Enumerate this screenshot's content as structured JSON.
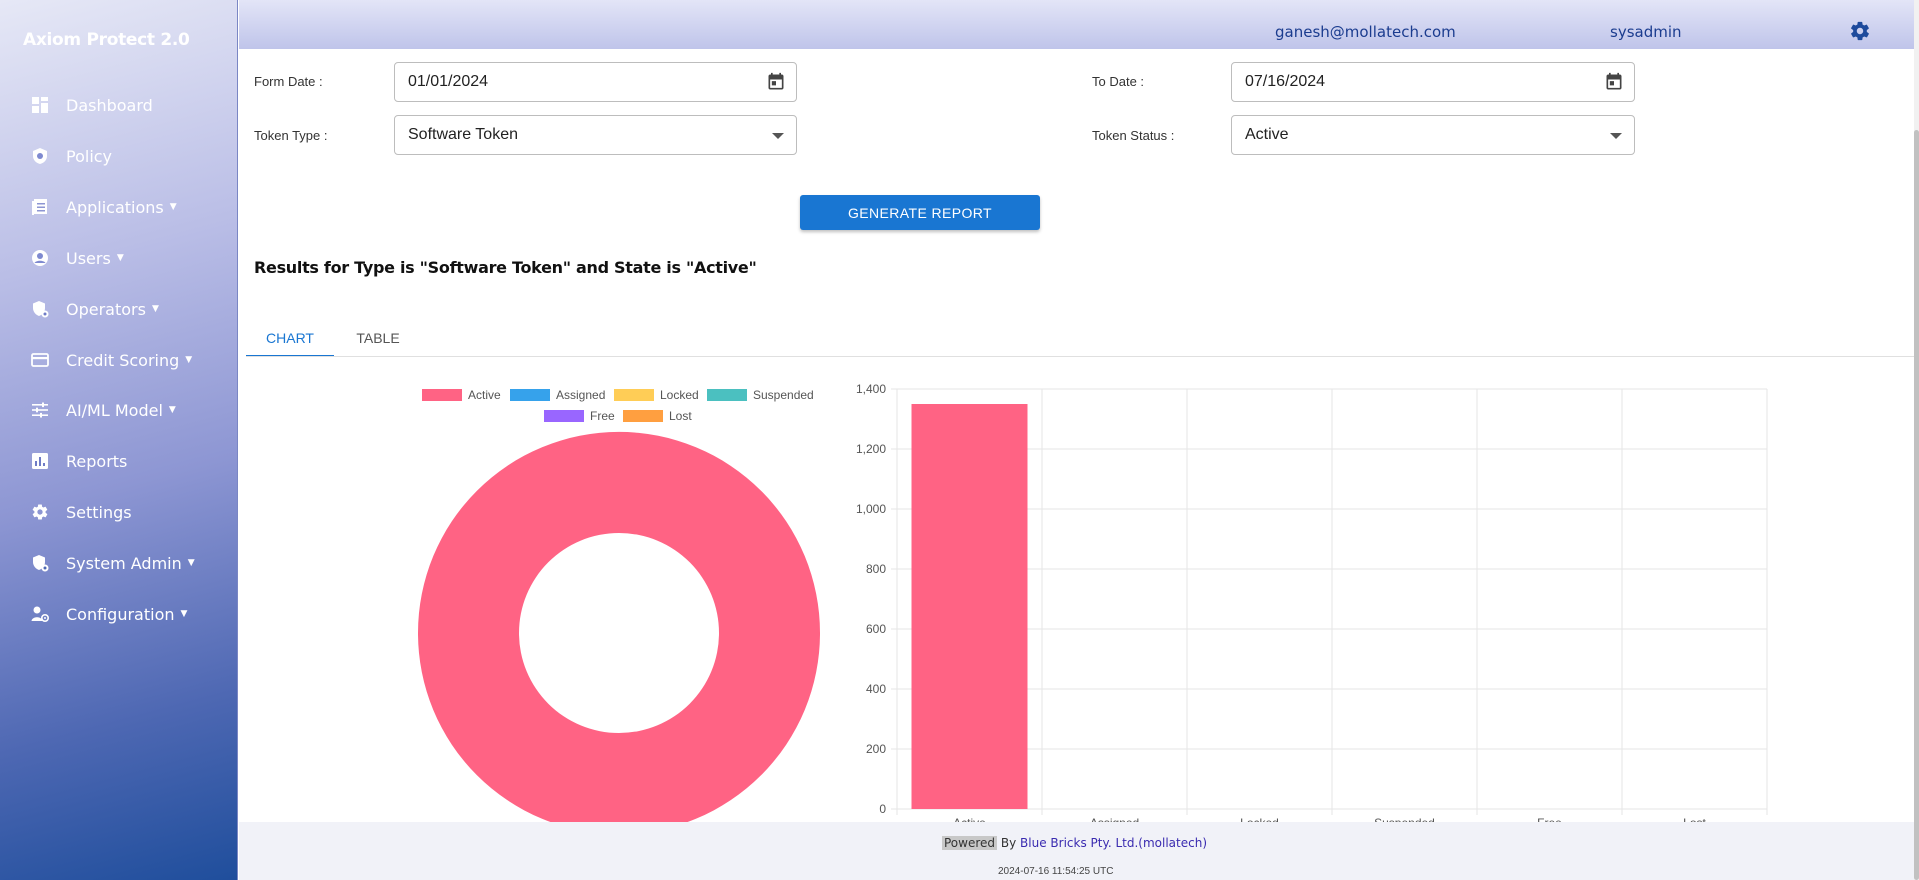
{
  "app": {
    "title": "Axiom Protect 2.0"
  },
  "sidebar": {
    "items": [
      {
        "label": "Dashboard",
        "icon": "dashboard-icon",
        "has_caret": false
      },
      {
        "label": "Policy",
        "icon": "policy-shield-icon",
        "has_caret": false
      },
      {
        "label": "Applications",
        "icon": "applications-icon",
        "has_caret": true
      },
      {
        "label": "Users",
        "icon": "user-circle-icon",
        "has_caret": true
      },
      {
        "label": "Operators",
        "icon": "operators-icon",
        "has_caret": true
      },
      {
        "label": "Credit Scoring",
        "icon": "credit-card-icon",
        "has_caret": true
      },
      {
        "label": "AI/ML Model",
        "icon": "sliders-icon",
        "has_caret": true
      },
      {
        "label": "Reports",
        "icon": "reports-icon",
        "has_caret": false
      },
      {
        "label": "Settings",
        "icon": "gear-icon",
        "has_caret": false
      },
      {
        "label": "System Admin",
        "icon": "system-admin-icon",
        "has_caret": true
      },
      {
        "label": "Configuration",
        "icon": "configuration-icon",
        "has_caret": true
      }
    ]
  },
  "header": {
    "email": "ganesh@mollatech.com",
    "username": "sysadmin"
  },
  "form": {
    "from_date_label": "Form Date :",
    "from_date_value": "01/01/2024",
    "to_date_label": "To Date :",
    "to_date_value": "07/16/2024",
    "token_type_label": "Token Type :",
    "token_type_value": "Software Token",
    "token_status_label": "Token Status :",
    "token_status_value": "Active",
    "generate_label": "GENERATE REPORT"
  },
  "results_title": "Results for Type is \"Software Token\" and State is \"Active\"",
  "tabs": [
    {
      "label": "CHART"
    },
    {
      "label": "TABLE"
    }
  ],
  "colors": {
    "active": "#ff6384",
    "assigned": "#36a2eb",
    "locked": "#ffcd56",
    "suspended": "#4bc0c0",
    "free": "#9966ff",
    "lost": "#ff9f40",
    "accent": "#1976d2"
  },
  "chart_data": [
    {
      "type": "pie",
      "legend_position": "top",
      "labels": [
        "Active",
        "Assigned",
        "Locked",
        "Suspended",
        "Free",
        "Lost"
      ],
      "values": [
        1350,
        0,
        0,
        0,
        0,
        0
      ]
    },
    {
      "type": "bar",
      "categories": [
        "Active",
        "Assigned",
        "Locked",
        "Suspended",
        "Free",
        "Lost"
      ],
      "values": [
        1350,
        0,
        0,
        0,
        0,
        0
      ],
      "ylim": [
        0,
        1400
      ],
      "yticks": [
        "0",
        "200",
        "400",
        "600",
        "800",
        "1,000",
        "1,200",
        "1,400"
      ],
      "grid": true
    }
  ],
  "footer": {
    "powered": "Powered",
    "by": "By",
    "company": "Blue Bricks Pty. Ltd.(mollatech)",
    "timestamp": "2024-07-16 11:54:25 UTC"
  }
}
